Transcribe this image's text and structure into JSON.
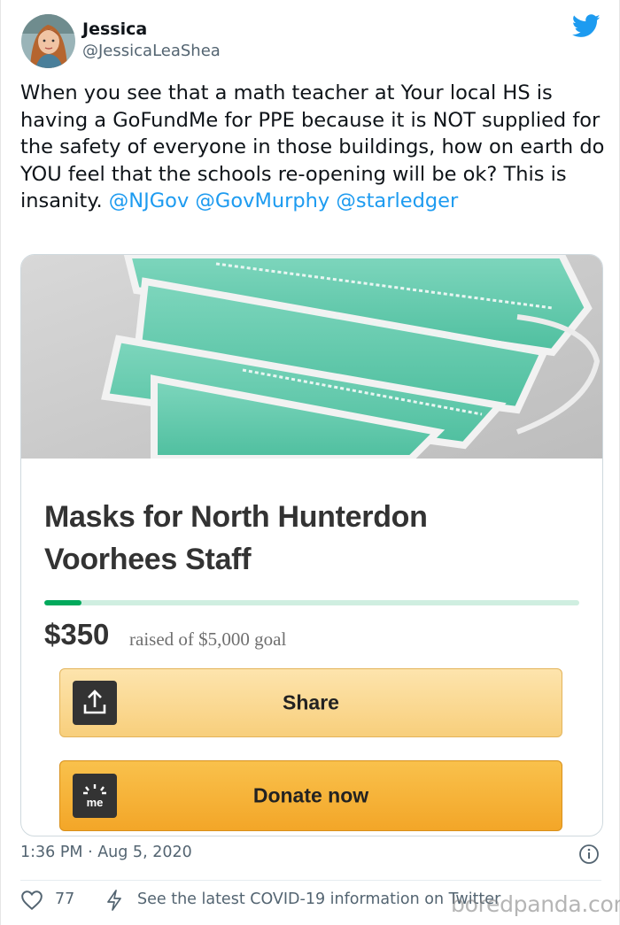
{
  "tweet": {
    "author": {
      "name": "Jessica",
      "handle": "@JessicaLeaShea",
      "avatar_icon": "profile-photo"
    },
    "brand_icon": "twitter-bird-icon",
    "brand_color": "#1d9bf0",
    "text_segments": [
      {
        "text": "When you see that a math teacher at Your local HS is having a GoFundMe for PPE because it is NOT supplied for the safety of everyone in those buildings, how on earth do YOU feel that the schools re-opening will be ok? This is insanity. ",
        "kind": "plain"
      },
      {
        "text": "@NJGov",
        "kind": "mention"
      },
      {
        "text": " ",
        "kind": "plain"
      },
      {
        "text": "@GovMurphy",
        "kind": "mention"
      },
      {
        "text": " ",
        "kind": "plain"
      },
      {
        "text": "@starledger",
        "kind": "mention"
      }
    ],
    "mention_color": "#1d9bf0",
    "timestamp": "1:36 PM · Aug 5, 2020",
    "info_icon": "info-icon",
    "like_count": "77",
    "like_icon": "heart-icon",
    "covid_icon": "lightning-bolt-icon",
    "covid_text": "See the latest COVID-19 information on Twitter"
  },
  "card": {
    "image_subject": "green surgical face masks",
    "title": "Masks for North Hunterdon Voorhees Staff",
    "progress_fraction": 0.07,
    "progress_color": "#02a95c",
    "raised_amount": "$350",
    "raised_goal_text": "raised of $5,000 goal",
    "share_label": "Share",
    "share_icon": "share-upload-icon",
    "donate_label": "Donate now",
    "donate_icon": "gofundme-logo-icon",
    "donate_color": "#f6b23a"
  },
  "watermark": "boredpanda.com"
}
